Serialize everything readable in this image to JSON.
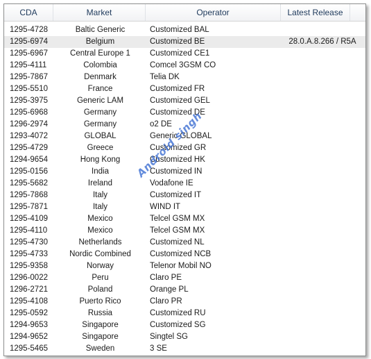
{
  "columns": {
    "cda": "CDA",
    "market": "Market",
    "operator": "Operator",
    "latest_release": "Latest Release"
  },
  "rows": [
    {
      "cda": "1295-4728",
      "market": "Baltic Generic",
      "operator": "Customized BAL",
      "latest": ""
    },
    {
      "cda": "1295-6974",
      "market": "Belgium",
      "operator": "Customized BE",
      "latest": "28.0.A.8.266 / R5A",
      "selected": true
    },
    {
      "cda": "1295-6967",
      "market": "Central Europe 1",
      "operator": "Customized CE1",
      "latest": ""
    },
    {
      "cda": "1295-4111",
      "market": "Colombia",
      "operator": "Comcel 3GSM CO",
      "latest": ""
    },
    {
      "cda": "1295-7867",
      "market": "Denmark",
      "operator": "Telia DK",
      "latest": ""
    },
    {
      "cda": "1295-5510",
      "market": "France",
      "operator": "Customized FR",
      "latest": ""
    },
    {
      "cda": "1295-3975",
      "market": "Generic LAM",
      "operator": "Customized GEL",
      "latest": ""
    },
    {
      "cda": "1295-6968",
      "market": "Germany",
      "operator": "Customized DE",
      "latest": ""
    },
    {
      "cda": "1296-2974",
      "market": "Germany",
      "operator": "o2 DE",
      "latest": ""
    },
    {
      "cda": "1293-4072",
      "market": "GLOBAL",
      "operator": "Generic GLOBAL",
      "latest": ""
    },
    {
      "cda": "1295-4729",
      "market": "Greece",
      "operator": "Customized GR",
      "latest": ""
    },
    {
      "cda": "1294-9654",
      "market": "Hong Kong",
      "operator": "Customized HK",
      "latest": ""
    },
    {
      "cda": "1295-0156",
      "market": "India",
      "operator": "Customized IN",
      "latest": ""
    },
    {
      "cda": "1295-5682",
      "market": "Ireland",
      "operator": "Vodafone IE",
      "latest": ""
    },
    {
      "cda": "1295-7868",
      "market": "Italy",
      "operator": "Customized IT",
      "latest": ""
    },
    {
      "cda": "1295-7871",
      "market": "Italy",
      "operator": "WIND IT",
      "latest": ""
    },
    {
      "cda": "1295-4109",
      "market": "Mexico",
      "operator": "Telcel GSM MX",
      "latest": ""
    },
    {
      "cda": "1295-4110",
      "market": "Mexico",
      "operator": "Telcel GSM MX",
      "latest": ""
    },
    {
      "cda": "1295-4730",
      "market": "Netherlands",
      "operator": "Customized NL",
      "latest": ""
    },
    {
      "cda": "1295-4733",
      "market": "Nordic Combined",
      "operator": "Customized NCB",
      "latest": ""
    },
    {
      "cda": "1295-9358",
      "market": "Norway",
      "operator": "Telenor Mobil NO",
      "latest": ""
    },
    {
      "cda": "1296-0022",
      "market": "Peru",
      "operator": "Claro PE",
      "latest": ""
    },
    {
      "cda": "1296-2721",
      "market": "Poland",
      "operator": "Orange PL",
      "latest": ""
    },
    {
      "cda": "1295-4108",
      "market": "Puerto Rico",
      "operator": "Claro PR",
      "latest": ""
    },
    {
      "cda": "1295-0592",
      "market": "Russia",
      "operator": "Customized RU",
      "latest": ""
    },
    {
      "cda": "1294-9653",
      "market": "Singapore",
      "operator": "Customized SG",
      "latest": ""
    },
    {
      "cda": "1294-9652",
      "market": "Singapore",
      "operator": "Singtel SG",
      "latest": ""
    },
    {
      "cda": "1295-5465",
      "market": "Sweden",
      "operator": "3 SE",
      "latest": ""
    }
  ],
  "watermark": "Android singh",
  "colors": {
    "header_text": "#1e395b",
    "selected_row": "#ebebeb",
    "watermark": "#3c6ed2"
  }
}
